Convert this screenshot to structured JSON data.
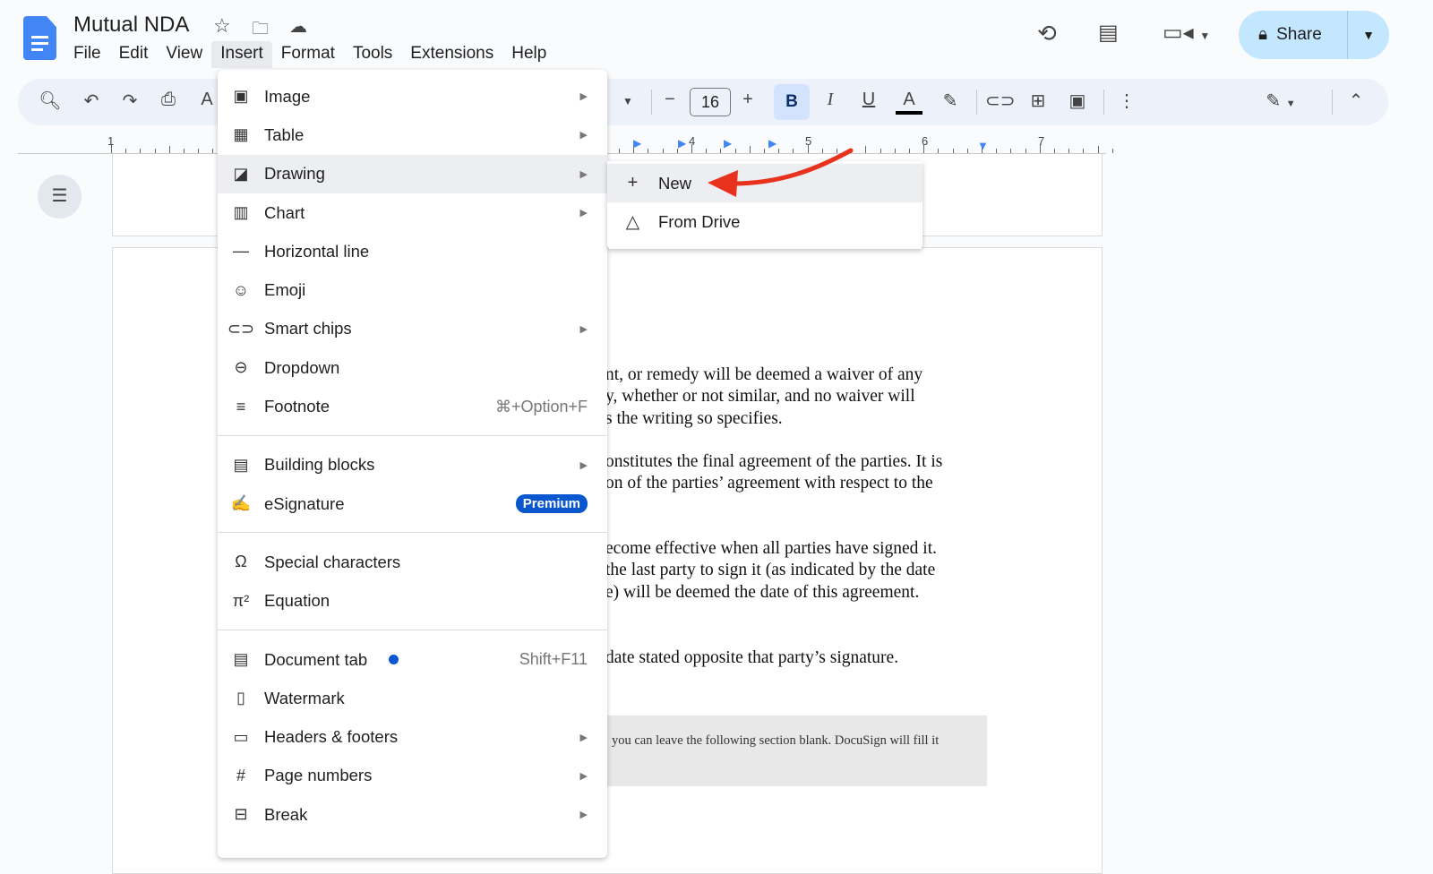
{
  "header": {
    "title": "Mutual NDA",
    "menus": [
      "File",
      "Edit",
      "View",
      "Insert",
      "Format",
      "Tools",
      "Extensions",
      "Help"
    ],
    "share_label": "Share"
  },
  "toolbar": {
    "font_size": "16",
    "bold": "B",
    "italic": "I",
    "underline": "U",
    "text_color": "A"
  },
  "ruler": {
    "labels": [
      "1",
      "4",
      "5",
      "6",
      "7"
    ]
  },
  "insert_menu": {
    "items": [
      {
        "label": "Image",
        "icon": "image-icon",
        "submenu": true
      },
      {
        "label": "Table",
        "icon": "table-icon",
        "submenu": true
      },
      {
        "label": "Drawing",
        "icon": "drawing-icon",
        "submenu": true,
        "highlighted": true
      },
      {
        "label": "Chart",
        "icon": "chart-icon",
        "submenu": true
      },
      {
        "label": "Horizontal line",
        "icon": "horizontal-line-icon"
      },
      {
        "label": "Emoji",
        "icon": "emoji-icon"
      },
      {
        "label": "Smart chips",
        "icon": "smart-chips-icon",
        "submenu": true
      },
      {
        "label": "Dropdown",
        "icon": "dropdown-icon"
      },
      {
        "label": "Footnote",
        "icon": "footnote-icon",
        "shortcut": "⌘+Option+F"
      },
      {
        "label": "Building blocks",
        "icon": "building-blocks-icon",
        "submenu": true
      },
      {
        "label": "eSignature",
        "icon": "esignature-icon",
        "badge": "Premium"
      },
      {
        "label": "Special characters",
        "icon": "omega-icon"
      },
      {
        "label": "Equation",
        "icon": "pi-icon"
      },
      {
        "label": "Document tab",
        "icon": "document-tab-icon",
        "shortcut": "Shift+F11",
        "new_dot": true
      },
      {
        "label": "Watermark",
        "icon": "watermark-icon"
      },
      {
        "label": "Headers & footers",
        "icon": "headers-footers-icon",
        "submenu": true
      },
      {
        "label": "Page numbers",
        "icon": "hash-icon",
        "submenu": true
      },
      {
        "label": "Break",
        "icon": "break-icon",
        "submenu": true
      }
    ]
  },
  "drawing_submenu": {
    "items": [
      {
        "label": "New",
        "icon": "plus-icon"
      },
      {
        "label": "From Drive",
        "icon": "drive-icon"
      }
    ]
  },
  "document": {
    "paragraphs": [
      [
        "nt, or remedy will be deemed a waiver of any",
        "y, whether or not similar, and no waiver will",
        "s the writing so specifies."
      ],
      [
        "onstitutes the final agreement of the parties. It is",
        "on of the parties’ agreement with respect to the"
      ],
      [
        "ecome effective when all parties have signed it.",
        " the last party to sign it (as indicated by the date",
        "e) will be deemed the date of this agreement."
      ],
      [
        "date stated opposite that party’s signature."
      ]
    ],
    "note": "you can leave the following section blank. DocuSign will fill it"
  },
  "colors": {
    "accent": "#0b57d0",
    "share_bg": "#c2e7ff",
    "arrow": "#e8321e"
  }
}
